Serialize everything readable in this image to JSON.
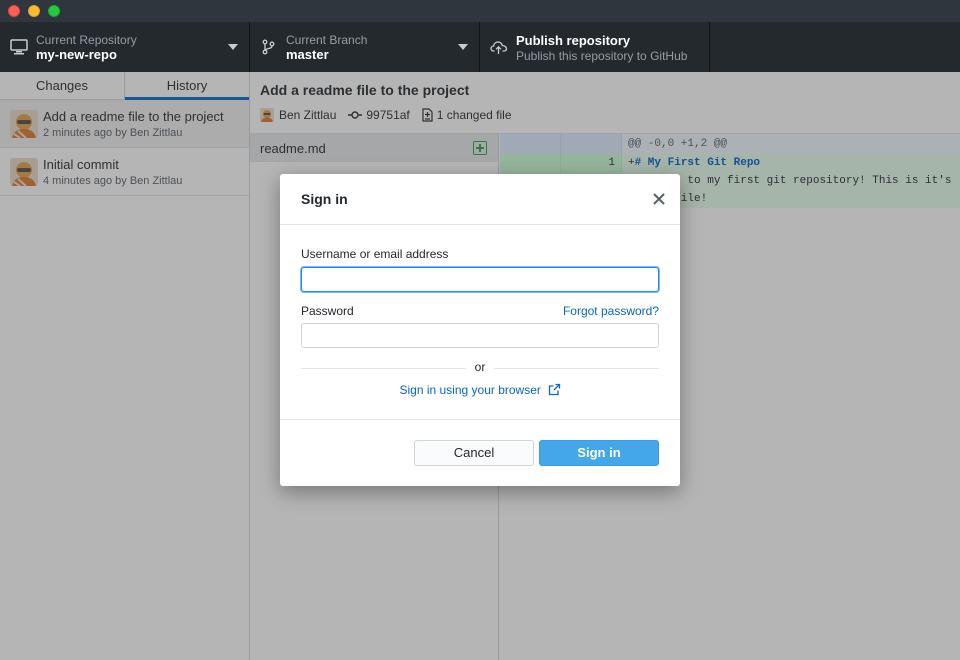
{
  "toolbar": {
    "repo": {
      "label": "Current Repository",
      "value": "my-new-repo",
      "icon": "computer-icon"
    },
    "branch": {
      "label": "Current Branch",
      "value": "master",
      "icon": "branch-icon"
    },
    "publish": {
      "title": "Publish repository",
      "subtitle": "Publish this repository to GitHub",
      "icon": "cloud-upload-icon"
    }
  },
  "sidebar": {
    "tabs": [
      {
        "label": "Changes",
        "active": false
      },
      {
        "label": "History",
        "active": true
      }
    ],
    "commits": [
      {
        "title": "Add a readme file to the project",
        "meta": "2 minutes ago by Ben Zittlau",
        "selected": true
      },
      {
        "title": "Initial commit",
        "meta": "4 minutes ago by Ben Zittlau",
        "selected": false
      }
    ]
  },
  "commit": {
    "summary": "Add a readme file to the project",
    "author": "Ben Zittlau",
    "sha": "99751af",
    "changed_files": "1 changed file"
  },
  "files": [
    {
      "name": "readme.md",
      "status": "added"
    }
  ],
  "diff": {
    "hunk": "@@ -0,0 +1,2 @@",
    "lines": [
      {
        "new_line": "1",
        "prefix": "+",
        "text": "# My First Git Repo",
        "heading": true
      },
      {
        "new_line": "2",
        "prefix": "+",
        "text": "Welcome to my first git repository! This is it's",
        "heading": false
      },
      {
        "new_line": "",
        "prefix": "",
        "text": "readme file!",
        "heading": false
      }
    ]
  },
  "dialog": {
    "title": "Sign in",
    "username_label": "Username or email address",
    "username_value": "",
    "password_label": "Password",
    "password_value": "",
    "forgot_link": "Forgot password?",
    "or_text": "or",
    "browser_link": "Sign in using your browser",
    "cancel_label": "Cancel",
    "signin_label": "Sign in"
  },
  "colors": {
    "accent": "#0366d6",
    "primary_button": "#44a7e8",
    "toolbar_bg": "#24292e",
    "added": "#28a745"
  }
}
